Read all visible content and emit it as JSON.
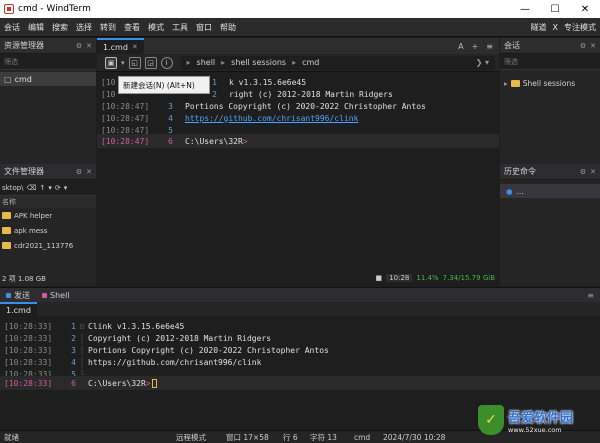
{
  "window": {
    "title": "cmd - WindTerm"
  },
  "menu": {
    "items": [
      "会话",
      "编辑",
      "搜索",
      "选择",
      "转到",
      "查看",
      "模式",
      "工具",
      "窗口",
      "帮助"
    ],
    "right": {
      "tunnel": "隧道",
      "close": "X",
      "focus": "专注模式"
    }
  },
  "explorer": {
    "title": "资源管理器",
    "filter_placeholder": "筛选",
    "item": "cmd"
  },
  "filemgr": {
    "title": "文件管理器",
    "path": "sktop\\",
    "col_name": "名称",
    "files": [
      "APK helper",
      "apk mess",
      "cdr2021_113776"
    ],
    "status": "2 项 1.08 GB"
  },
  "session_panel": {
    "title": "会话",
    "filter_placeholder": "筛选",
    "item": "Shell sessions"
  },
  "history_panel": {
    "title": "历史命令",
    "item": "..."
  },
  "terminal": {
    "tab_label": "1.cmd",
    "crumbs": [
      "shell",
      "shell sessions",
      "cmd"
    ],
    "tooltip": "新建会话(N) (Alt+N)",
    "lines": [
      {
        "ts": "[10",
        "ln": "1",
        "text": "k v1.3.15.6e6e45"
      },
      {
        "ts": "[10",
        "ln": "2",
        "text": "right (c) 2012-2018 Martin Ridgers"
      },
      {
        "ts": "[10:28:47]",
        "ln": "3",
        "text": "Portions Copyright (c) 2020-2022 Christopher Antos"
      },
      {
        "ts": "[10:28:47]",
        "ln": "4",
        "text": "https://github.com/chrisant996/clink"
      },
      {
        "ts": "[10:28:47]",
        "ln": "5",
        "text": ""
      },
      {
        "ts": "[10:28:47]",
        "ln": "6",
        "text": "C:\\Users\\32R"
      }
    ],
    "prompt_symbol": ">",
    "status": {
      "clock": "10:28",
      "cpu": "11.4%",
      "mem": "7.34/15.79 GiB"
    }
  },
  "bottom": {
    "tabs": [
      {
        "label": "发送",
        "color": "#3b8eea"
      },
      {
        "label": "Shell",
        "color": "#d05c9e"
      }
    ],
    "subtab": "1.cmd",
    "lines": [
      {
        "ts": "[10:28:33]",
        "ln": "1",
        "text": "Clink v1.3.15.6e6e45"
      },
      {
        "ts": "[10:28:33]",
        "ln": "2",
        "text": "Copyright (c) 2012-2018 Martin Ridgers"
      },
      {
        "ts": "[10:28:33]",
        "ln": "3",
        "text": "Portions Copyright (c) 2020-2022 Christopher Antos"
      },
      {
        "ts": "[10:28:33]",
        "ln": "4",
        "text": "https://github.com/chrisant996/clink"
      },
      {
        "ts": "[10:28:33]",
        "ln": "5",
        "text": ""
      },
      {
        "ts": "[10:28:33]",
        "ln": "6",
        "text": "C:\\Users\\32R"
      }
    ],
    "prompt_symbol": ">"
  },
  "statusbar": {
    "ready": "就绪",
    "mode": "远程模式",
    "window": "窗口 17×58",
    "line": "行 6",
    "char": "字符 13",
    "shell": "cmd",
    "datetime": "2024/7/30 10:28"
  },
  "watermark": {
    "text": "吾爱软件园",
    "url": "www.52xue.com",
    "glyph": "✓"
  }
}
